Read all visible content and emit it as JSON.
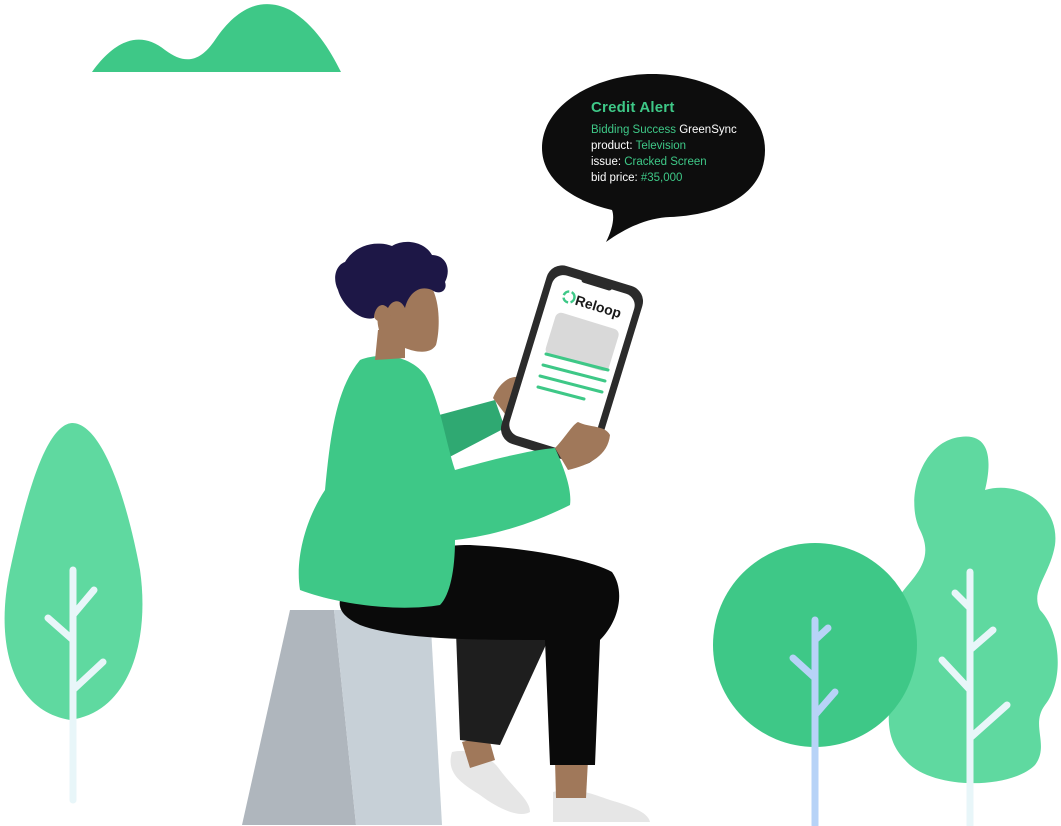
{
  "alert": {
    "title": "Credit Alert",
    "line1_label": "Bidding Success",
    "line1_value": "GreenSync",
    "line2_label": "product:",
    "line2_value": "Television",
    "line3_label": "issue:",
    "line3_value": "Cracked Screen",
    "line4_label": "bid price:",
    "line4_value": "#35,000"
  },
  "phone": {
    "brand": "Reloop"
  },
  "colors": {
    "brand_green": "#3ec887",
    "light_green": "#5fd9a0",
    "dark_green": "#2fa972",
    "bubble": "#0d0d0d",
    "skin": "#a0785a",
    "hair": "#1d1746",
    "rock_dark": "#afb6bd",
    "rock_light": "#c7d0d7"
  },
  "icons": [
    "recycle-icon"
  ]
}
